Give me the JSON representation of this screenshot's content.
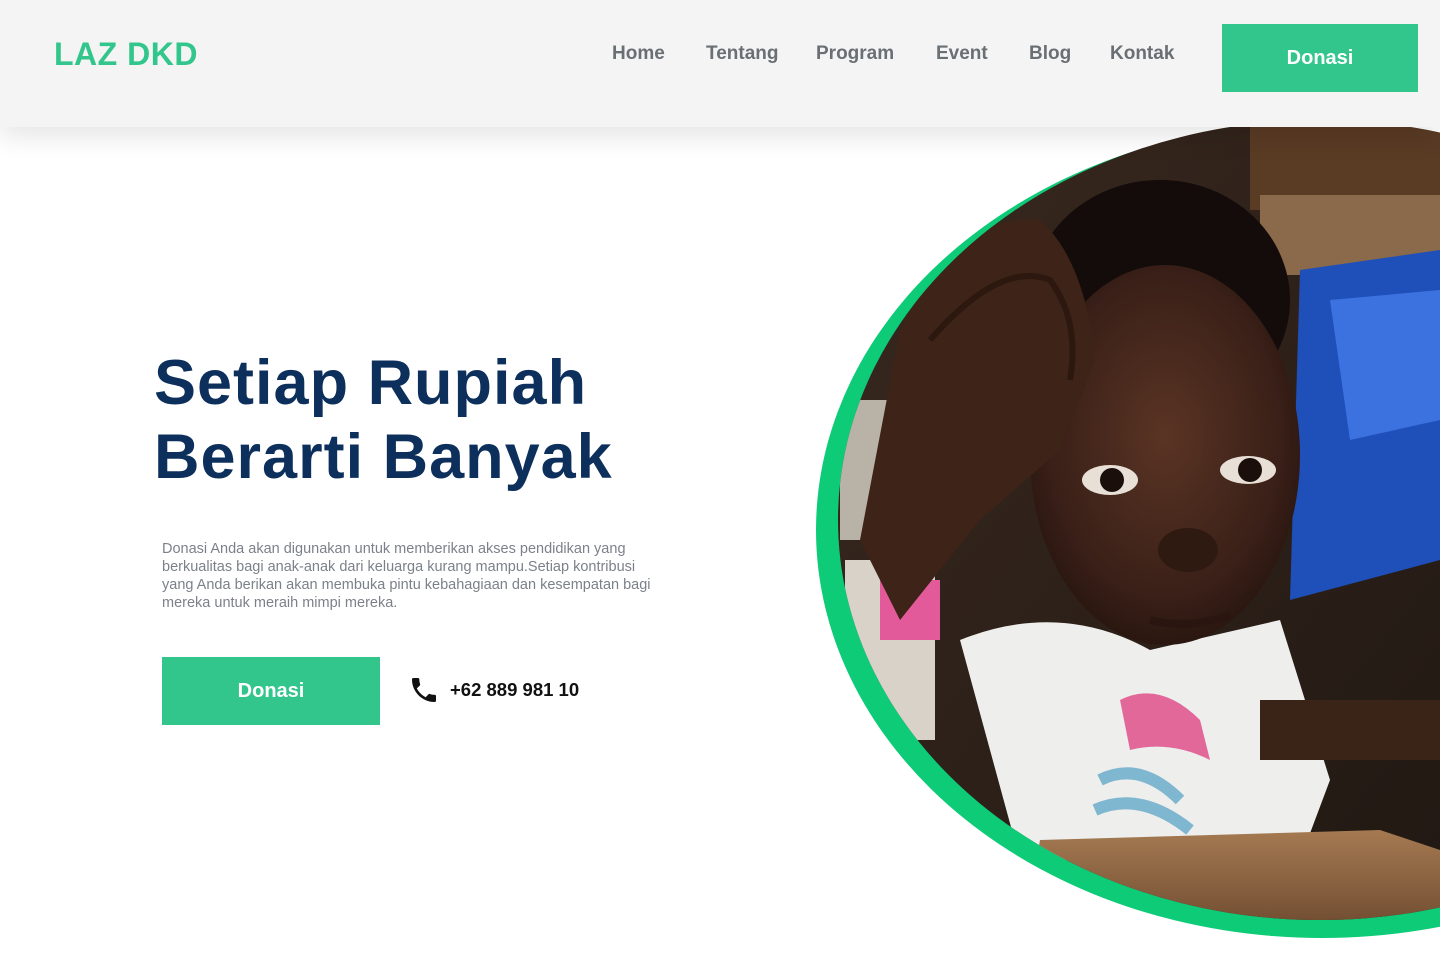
{
  "header": {
    "logo": "LAZ DKD",
    "nav": [
      "Home",
      "Tentang",
      "Program",
      "Event",
      "Blog",
      "Kontak"
    ],
    "cta_label": "Donasi"
  },
  "hero": {
    "title_line1": "Setiap Rupiah",
    "title_line2": "Berarti Banyak",
    "description": "Donasi Anda akan digunakan untuk memberikan akses pendidikan yang berkualitas bagi anak-anak dari keluarga kurang mampu.Setiap kontribusi yang Anda berikan akan membuka pintu kebahagiaan dan kesempatan bagi mereka untuk meraih mimpi mereka.",
    "cta_label": "Donasi",
    "phone": "+62 889 981 10",
    "phone_icon": "phone-icon",
    "image_subject": "child-resting-head-on-hand-photo"
  },
  "colors": {
    "brand_green": "#33c68c",
    "ring_green": "#0ecb78",
    "title_navy": "#0c2f5c",
    "nav_gray": "#6a6f74",
    "header_bg": "#f4f4f4"
  }
}
